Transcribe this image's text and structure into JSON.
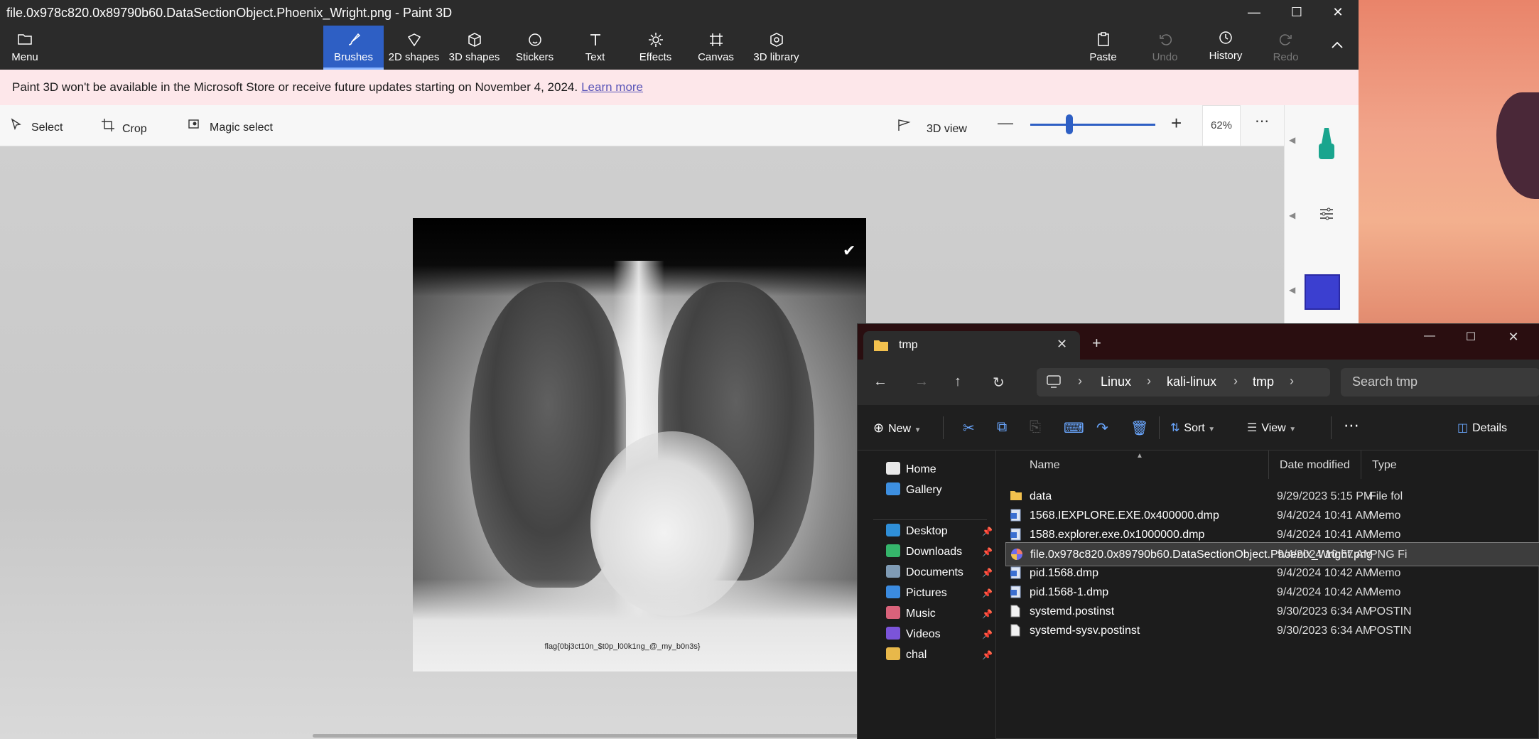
{
  "paint": {
    "title": "file.0x978c820.0x89790b60.DataSectionObject.Phoenix_Wright.png - Paint 3D",
    "menu_label": "Menu",
    "tools": [
      {
        "label": "Brushes",
        "icon": "brush-icon"
      },
      {
        "label": "2D shapes",
        "icon": "2d-shapes-icon"
      },
      {
        "label": "3D shapes",
        "icon": "3d-shapes-icon"
      },
      {
        "label": "Stickers",
        "icon": "stickers-icon"
      },
      {
        "label": "Text",
        "icon": "text-icon"
      },
      {
        "label": "Effects",
        "icon": "effects-icon"
      },
      {
        "label": "Canvas",
        "icon": "canvas-icon"
      },
      {
        "label": "3D library",
        "icon": "3d-library-icon"
      }
    ],
    "right_tools": [
      {
        "label": "Paste",
        "icon": "paste-icon"
      },
      {
        "label": "Undo",
        "icon": "undo-icon"
      },
      {
        "label": "History",
        "icon": "history-icon"
      },
      {
        "label": "Redo",
        "icon": "redo-icon"
      }
    ],
    "notice": {
      "text": "Paint 3D won't be available in the Microsoft Store or receive future updates starting on November 4, 2024.",
      "link": "Learn more"
    },
    "select_label": "Select",
    "crop_label": "Crop",
    "magic_select_label": "Magic select",
    "view3d_label": "3D view",
    "zoom_percent": "62%",
    "zoom_fraction": 0.31,
    "brush_color": "#1aa58e",
    "selected_color": "#3b3fd0",
    "image_caption": "flag{0bj3ct10n_$t0p_l00k1ng_@_my_b0n3s}"
  },
  "explorer": {
    "tab_title": "tmp",
    "breadcrumb": [
      "Linux",
      "kali-linux",
      "tmp"
    ],
    "search_placeholder": "Search tmp",
    "cmd": {
      "new": "New",
      "sort": "Sort",
      "view": "View",
      "details": "Details"
    },
    "columns": {
      "name": "Name",
      "date": "Date modified",
      "type": "Type"
    },
    "nav": [
      {
        "label": "Home",
        "color": "#e8e8e8",
        "pinned": false
      },
      {
        "label": "Gallery",
        "color": "#3d8fe0",
        "pinned": false
      },
      {
        "label": "Desktop",
        "color": "#2f8fd8",
        "pinned": true
      },
      {
        "label": "Downloads",
        "color": "#35b56b",
        "pinned": true
      },
      {
        "label": "Documents",
        "color": "#7f9bb5",
        "pinned": true
      },
      {
        "label": "Pictures",
        "color": "#3b8be0",
        "pinned": true
      },
      {
        "label": "Music",
        "color": "#d9627a",
        "pinned": true
      },
      {
        "label": "Videos",
        "color": "#7b54d9",
        "pinned": true
      },
      {
        "label": "chal",
        "color": "#e8b84a",
        "pinned": true
      }
    ],
    "files": [
      {
        "name": "data",
        "date": "9/29/2023 5:15 PM",
        "type": "File fol",
        "kind": "folder"
      },
      {
        "name": "1568.IEXPLORE.EXE.0x400000.dmp",
        "date": "9/4/2024 10:41 AM",
        "type": "Memo",
        "kind": "dmp"
      },
      {
        "name": "1588.explorer.exe.0x1000000.dmp",
        "date": "9/4/2024 10:41 AM",
        "type": "Memo",
        "kind": "dmp"
      },
      {
        "name": "file.0x978c820.0x89790b60.DataSectionObject.Phoenix_Wright.png",
        "date": "9/4/2024 10:57 AM",
        "type": "PNG Fi",
        "kind": "png",
        "selected": true
      },
      {
        "name": "pid.1568.dmp",
        "date": "9/4/2024 10:42 AM",
        "type": "Memo",
        "kind": "dmp"
      },
      {
        "name": "pid.1568-1.dmp",
        "date": "9/4/2024 10:42 AM",
        "type": "Memo",
        "kind": "dmp"
      },
      {
        "name": "systemd.postinst",
        "date": "9/30/2023 6:34 AM",
        "type": "POSTIN",
        "kind": "file"
      },
      {
        "name": "systemd-sysv.postinst",
        "date": "9/30/2023 6:34 AM",
        "type": "POSTIN",
        "kind": "file"
      }
    ]
  }
}
